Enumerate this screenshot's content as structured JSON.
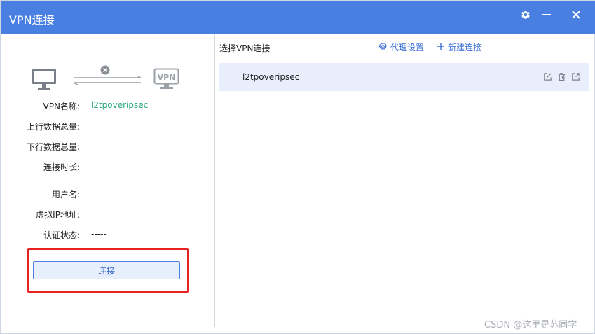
{
  "window": {
    "title": "VPN连接",
    "accent_color": "#4a7fe2"
  },
  "titlebar_icons": [
    "gear-icon",
    "minimize-icon",
    "close-icon"
  ],
  "diagram": {
    "left_icon": "monitor-icon",
    "middle_icon": "disconnected-x-icon",
    "right_icon": "vpn-icon",
    "right_icon_text": "VPN"
  },
  "info": {
    "vpn_name_label": "VPN名称:",
    "vpn_name_value": "l2tpoveripsec",
    "upload_label": "上行数据总量:",
    "upload_value": "",
    "download_label": "下行数据总量:",
    "download_value": "",
    "duration_label": "连接时长:",
    "duration_value": "",
    "username_label": "用户名:",
    "username_value": "",
    "virtual_ip_label": "虚拟IP地址:",
    "virtual_ip_value": "",
    "auth_status_label": "认证状态:",
    "auth_status_value": "-----"
  },
  "connect_button": {
    "label": "连接",
    "highlight_color": "#e8221e"
  },
  "right_panel": {
    "title": "选择VPN连接",
    "proxy_settings_label": "代理设置",
    "new_connection_label": "新建连接",
    "connections": [
      {
        "name": "l2tpoveripsec",
        "selected": true,
        "actions": [
          "edit-icon",
          "delete-icon",
          "export-icon"
        ]
      }
    ]
  },
  "watermark": "CSDN @这里是苏同学"
}
